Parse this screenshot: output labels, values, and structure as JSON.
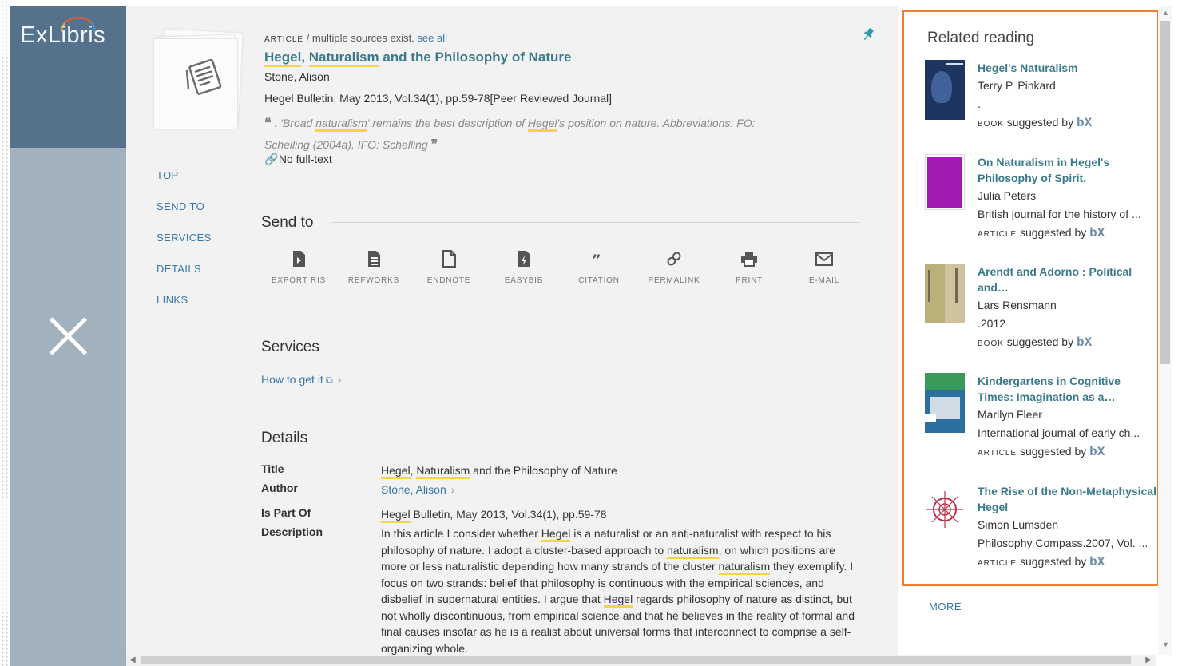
{
  "app": {
    "logo_text": "ExLibris"
  },
  "record": {
    "type_label": "ARTICLE",
    "sources_text": "/ multiple sources exist.",
    "see_all": "see all",
    "title_parts": [
      "Hegel",
      ", ",
      "Naturalism",
      " and the Philosophy of Nature"
    ],
    "author": "Stone, Alison",
    "source": "Hegel Bulletin, May 2013, Vol.34(1), pp.59-78[Peer Reviewed Journal]",
    "snippet_line1_parts": [
      ". 'Broad ",
      "naturalism",
      "' remains the best description of ",
      "Hegel",
      "'s position on nature. Abbreviations: FO:"
    ],
    "snippet_line2": "Schelling (2004a). IFO: Schelling",
    "fulltext_status": "No full-text"
  },
  "nav": {
    "items": [
      "TOP",
      "SEND TO",
      "SERVICES",
      "DETAILS",
      "LINKS"
    ]
  },
  "send_to": {
    "heading": "Send to",
    "actions": [
      {
        "label": "EXPORT RIS",
        "icon": "export-ris-icon"
      },
      {
        "label": "REFWORKS",
        "icon": "refworks-icon"
      },
      {
        "label": "ENDNOTE",
        "icon": "endnote-icon"
      },
      {
        "label": "EASYBIB",
        "icon": "easybib-icon"
      },
      {
        "label": "CITATION",
        "icon": "quote-icon"
      },
      {
        "label": "PERMALINK",
        "icon": "link-icon"
      },
      {
        "label": "PRINT",
        "icon": "printer-icon"
      },
      {
        "label": "E-MAIL",
        "icon": "envelope-icon"
      }
    ]
  },
  "services": {
    "heading": "Services",
    "how_to_get": "How to get it"
  },
  "details": {
    "heading": "Details",
    "labels": {
      "title": "Title",
      "author": "Author",
      "part_of": "Is Part Of",
      "description": "Description"
    },
    "title_parts": [
      "Hegel",
      ", ",
      "Naturalism",
      " and the Philosophy of Nature"
    ],
    "author": "Stone, Alison",
    "part_of_parts": [
      "Hegel",
      " Bulletin, May 2013, Vol.34(1), pp.59-78"
    ],
    "description_parts": [
      " In this article I consider whether ",
      "Hegel",
      " is a naturalist or an anti-naturalist with respect to his philosophy of nature. I adopt a cluster-based approach to ",
      "naturalism",
      ", on which positions are more or less naturalistic depending how many strands of the cluster ",
      "naturalism",
      " they exemplify. I focus on two strands: belief that philosophy is continuous with the empirical sciences, and disbelief in supernatural entities. I argue that ",
      "Hegel",
      " regards philosophy of nature as distinct, but not wholly discontinuous, from empirical science and that he believes in the reality of formal and final causes insofar as he is a realist about universal forms that interconnect to comprise a self-organizing whole."
    ]
  },
  "related": {
    "heading": "Related reading",
    "suggested_by": "suggested by",
    "bx_logo": "bX",
    "items": [
      {
        "title": "Hegel's Naturalism",
        "author": "Terry P. Pinkard",
        "source": ".",
        "type": "BOOK",
        "cover": "#2d4a7a"
      },
      {
        "title": "On Naturalism in Hegel's Philosophy of Spirit.",
        "author": "Julia Peters",
        "source": "British journal for the history of ...",
        "type": "ARTICLE",
        "cover": "#a020b0"
      },
      {
        "title": "Arendt and Adorno : Political and…",
        "author": "Lars Rensmann",
        "source": ".2012",
        "type": "BOOK",
        "cover": "#c9bb94"
      },
      {
        "title": "Kindergartens in Cognitive Times: Imagination as a…",
        "author": "Marilyn Fleer",
        "source": "International journal of early ch...",
        "type": "ARTICLE",
        "cover": "#2a6fa0"
      },
      {
        "title": "The Rise of the Non-Metaphysical Hegel",
        "author": "Simon Lumsden",
        "source": "Philosophy Compass.2007, Vol. ...",
        "type": "ARTICLE",
        "cover": "#b8324a"
      }
    ],
    "more_label": "MORE"
  },
  "colors": {
    "accent": "#3777a8",
    "title": "#3b7a8c",
    "highlight": "#f6d44a",
    "related_border": "#ed7d31",
    "logo_bar": "#55728d",
    "left_pane": "#a1b1bd"
  }
}
